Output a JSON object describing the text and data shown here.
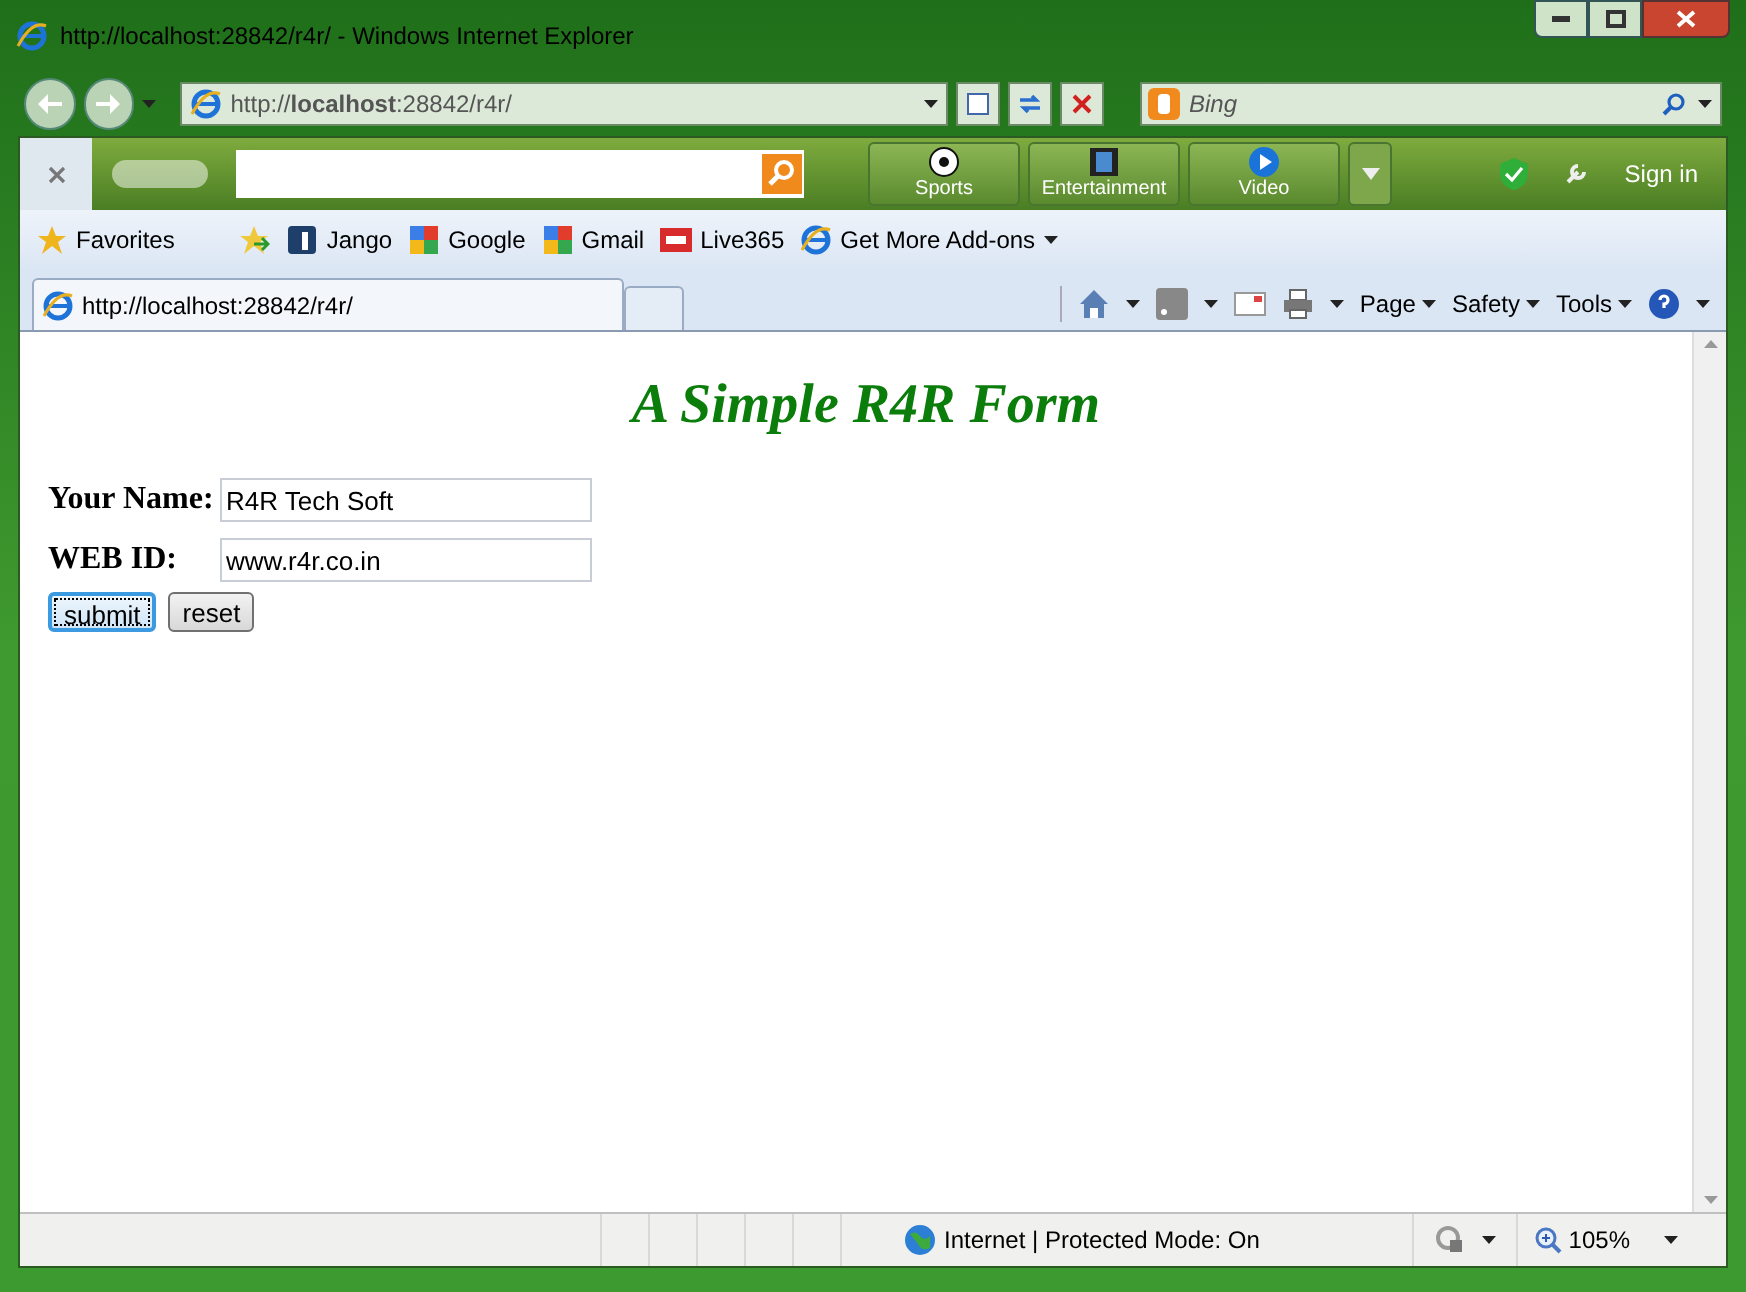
{
  "window": {
    "title": "http://localhost:28842/r4r/ - Windows Internet Explorer"
  },
  "address_bar": {
    "value": "http://**localhost**:28842/r4r/"
  },
  "search_box": {
    "placeholder": "Bing"
  },
  "bing_toolbar": {
    "buttons": [
      {
        "label": "Sports",
        "kind": "ball"
      },
      {
        "label": "Entertainment",
        "kind": "film"
      },
      {
        "label": "Video",
        "kind": "play"
      }
    ],
    "sign_in": "Sign in"
  },
  "favorites_bar": {
    "label": "Favorites",
    "links": [
      {
        "label": "Jango",
        "kind": "tile"
      },
      {
        "label": "Google",
        "kind": "blocks"
      },
      {
        "label": "Gmail",
        "kind": "blocks"
      },
      {
        "label": "Live365",
        "kind": "red"
      },
      {
        "label": "Get More Add-ons",
        "kind": "page"
      }
    ]
  },
  "tab": {
    "label": "http://localhost:28842/r4r/",
    "selected": true
  },
  "command_bar": [
    {
      "label": "Page"
    },
    {
      "label": "Safety"
    },
    {
      "label": "Tools"
    }
  ],
  "page": {
    "heading": "A Simple R4R Form",
    "fields": [
      {
        "label": "Your Name:",
        "value": "R4R Tech Soft"
      },
      {
        "label": "WEB ID:",
        "value": "www.r4r.co.in"
      }
    ],
    "buttons": [
      {
        "label": "submit",
        "focused": true
      },
      {
        "label": "reset",
        "focused": false
      }
    ]
  },
  "status_bar": {
    "zone": "Internet | Protected Mode: On",
    "zoom": "105%"
  }
}
